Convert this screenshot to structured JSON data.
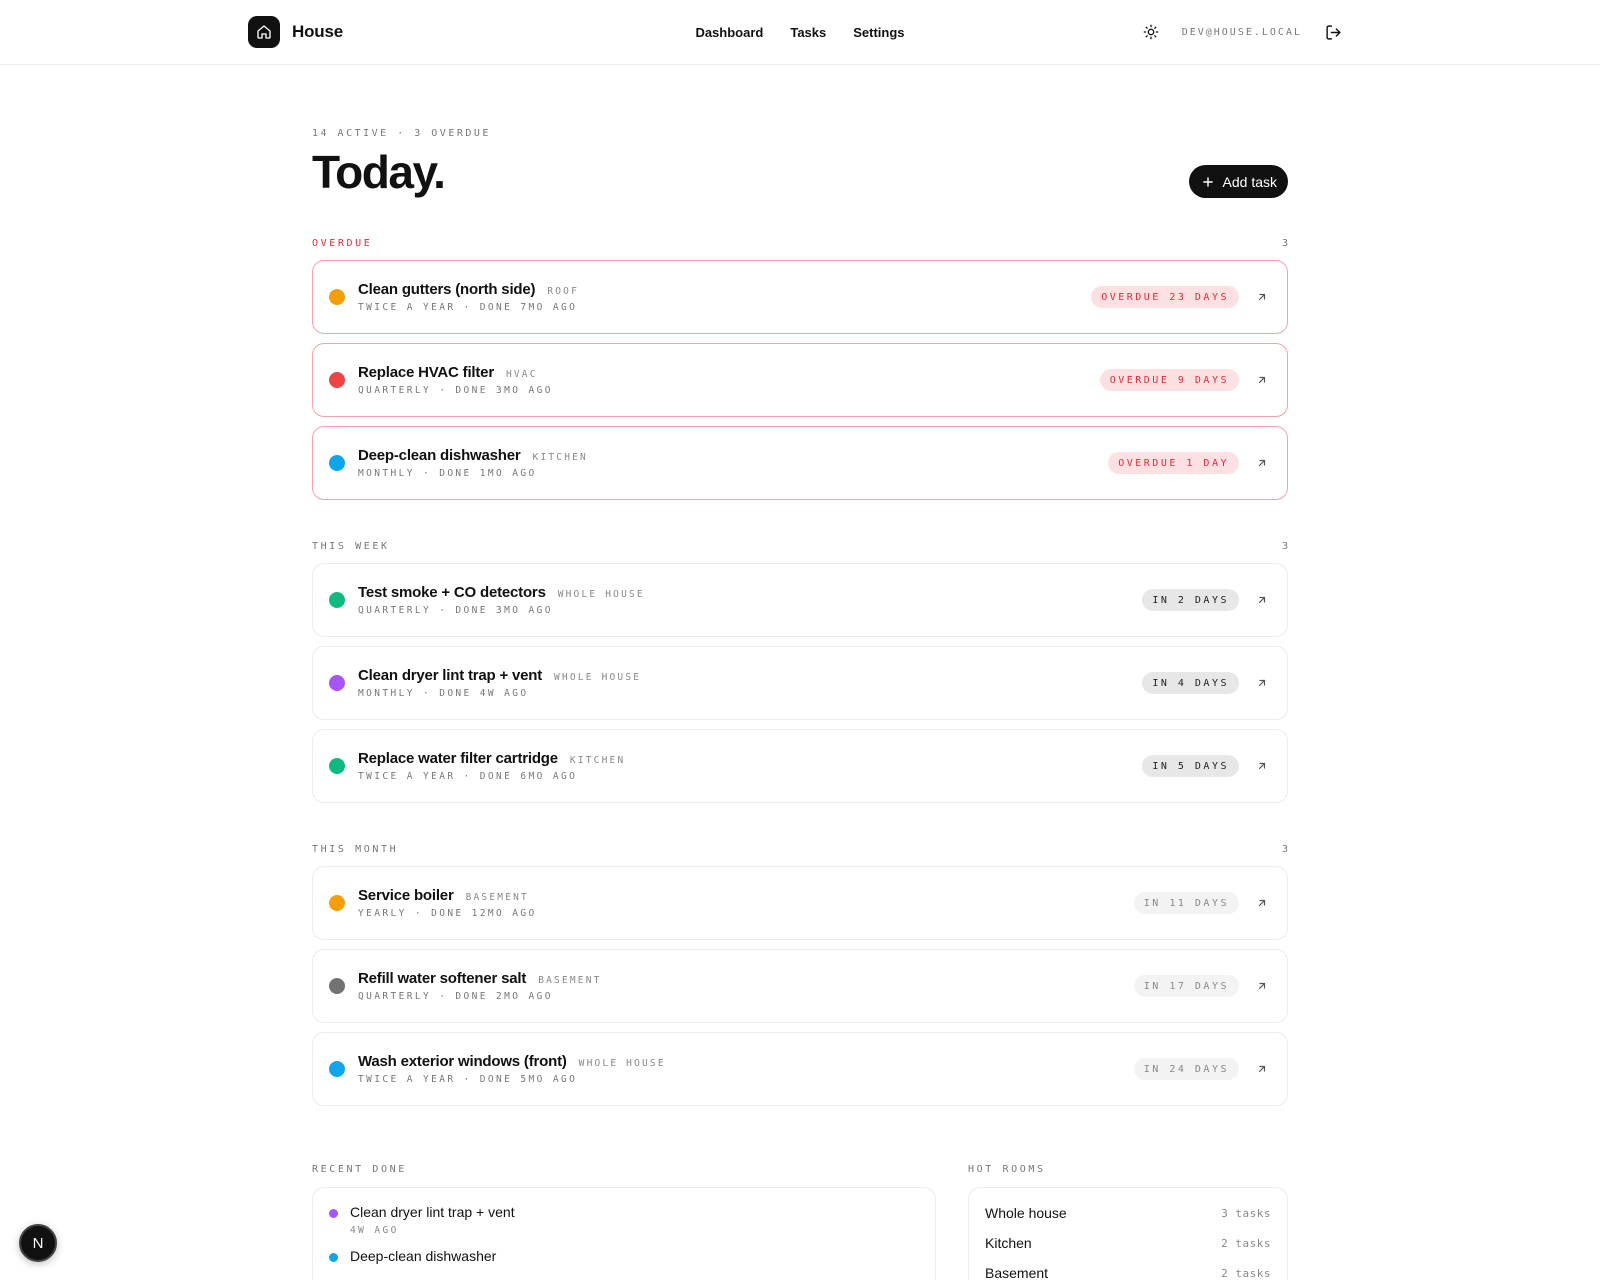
{
  "brand": {
    "name": "House",
    "icon": "home-icon"
  },
  "nav": {
    "items": [
      "Dashboard",
      "Tasks",
      "Settings"
    ]
  },
  "header": {
    "email": "DEV@HOUSE.LOCAL",
    "theme_icon": "sun-icon",
    "logout_icon": "logout-icon"
  },
  "page": {
    "stats": "14 ACTIVE · 3 OVERDUE",
    "title": "Today.",
    "add_label": "Add task"
  },
  "sections": [
    {
      "id": "overdue",
      "label": "OVERDUE",
      "count": "3",
      "variant": "overdue",
      "tasks": [
        {
          "title": "Clean gutters (north side)",
          "room": "ROOF",
          "meta": "TWICE A YEAR · DONE 7MO AGO",
          "badge": "OVERDUE 23 DAYS",
          "badge_style": "red",
          "color": "#f59e0b"
        },
        {
          "title": "Replace HVAC filter",
          "room": "HVAC",
          "meta": "QUARTERLY · DONE 3MO AGO",
          "badge": "OVERDUE 9 DAYS",
          "badge_style": "red",
          "color": "#ef4444"
        },
        {
          "title": "Deep-clean dishwasher",
          "room": "KITCHEN",
          "meta": "MONTHLY · DONE 1MO AGO",
          "badge": "OVERDUE 1 DAY",
          "badge_style": "red",
          "color": "#0ea5e9"
        }
      ]
    },
    {
      "id": "this-week",
      "label": "THIS WEEK",
      "count": "3",
      "variant": "normal",
      "tasks": [
        {
          "title": "Test smoke + CO detectors",
          "room": "WHOLE HOUSE",
          "meta": "QUARTERLY · DONE 3MO AGO",
          "badge": "IN 2 DAYS",
          "badge_style": "gray",
          "color": "#10b981"
        },
        {
          "title": "Clean dryer lint trap + vent",
          "room": "WHOLE HOUSE",
          "meta": "MONTHLY · DONE 4W AGO",
          "badge": "IN 4 DAYS",
          "badge_style": "gray",
          "color": "#a855f7"
        },
        {
          "title": "Replace water filter cartridge",
          "room": "KITCHEN",
          "meta": "TWICE A YEAR · DONE 6MO AGO",
          "badge": "IN 5 DAYS",
          "badge_style": "gray",
          "color": "#10b981"
        }
      ]
    },
    {
      "id": "this-month",
      "label": "THIS MONTH",
      "count": "3",
      "variant": "normal",
      "tasks": [
        {
          "title": "Service boiler",
          "room": "BASEMENT",
          "meta": "YEARLY · DONE 12MO AGO",
          "badge": "IN 11 DAYS",
          "badge_style": "light",
          "color": "#f59e0b"
        },
        {
          "title": "Refill water softener salt",
          "room": "BASEMENT",
          "meta": "QUARTERLY · DONE 2MO AGO",
          "badge": "IN 17 DAYS",
          "badge_style": "light",
          "color": "#737373"
        },
        {
          "title": "Wash exterior windows (front)",
          "room": "WHOLE HOUSE",
          "meta": "TWICE A YEAR · DONE 5MO AGO",
          "badge": "IN 24 DAYS",
          "badge_style": "light",
          "color": "#0ea5e9"
        }
      ]
    }
  ],
  "recent": {
    "label": "RECENT DONE",
    "items": [
      {
        "title": "Clean dryer lint trap + vent",
        "ago": "4W AGO",
        "color": "#a855f7"
      },
      {
        "title": "Deep-clean dishwasher",
        "ago": "",
        "color": "#0ea5e9"
      }
    ]
  },
  "rooms": {
    "label": "HOT ROOMS",
    "items": [
      {
        "name": "Whole house",
        "count": "3 tasks"
      },
      {
        "name": "Kitchen",
        "count": "2 tasks"
      },
      {
        "name": "Basement",
        "count": "2 tasks"
      }
    ]
  },
  "dev_badge": "N"
}
